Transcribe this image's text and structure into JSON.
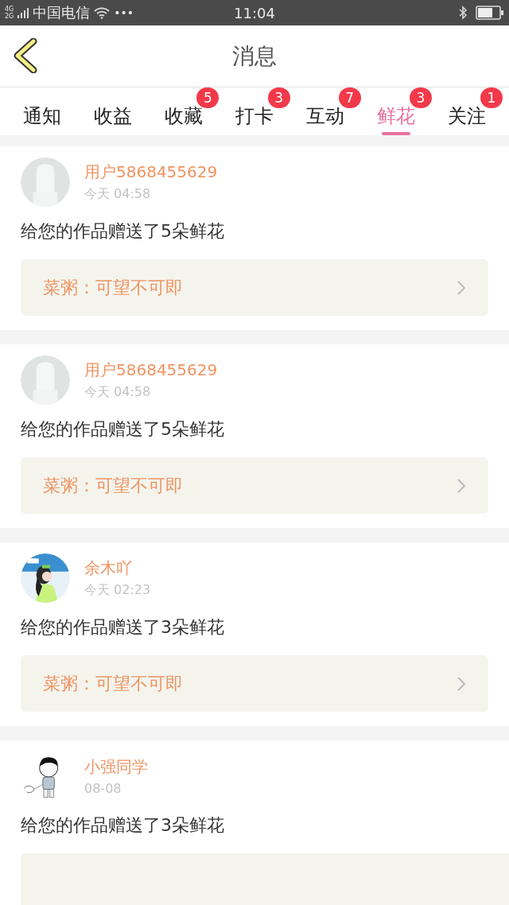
{
  "status_bar": {
    "network_top": "4G",
    "network_bottom": "2G",
    "carrier": "中国电信",
    "more": "•••",
    "time": "11:04"
  },
  "header": {
    "title": "消息"
  },
  "tabs": [
    {
      "label": "通知",
      "selected": false
    },
    {
      "label": "收益",
      "selected": false
    },
    {
      "label": "收藏",
      "selected": false,
      "badge": "5"
    },
    {
      "label": "打卡",
      "selected": false,
      "badge": "3"
    },
    {
      "label": "互动",
      "selected": false,
      "badge": "7"
    },
    {
      "label": "鲜花",
      "selected": true,
      "badge": "3"
    },
    {
      "label": "关注",
      "selected": false,
      "badge": "1"
    }
  ],
  "messages": [
    {
      "kind": "default",
      "user": "用户5868455629",
      "time": "今天 04:58",
      "text": "给您的作品赠送了5朵鲜花",
      "work": "菜粥：可望不可即"
    },
    {
      "kind": "default",
      "user": "用户5868455629",
      "time": "今天 04:58",
      "text": "给您的作品赠送了5朵鲜花",
      "work": "菜粥：可望不可即"
    },
    {
      "user": "余木吖",
      "time": "今天 02:23",
      "text": "给您的作品赠送了3朵鲜花",
      "work": "菜粥：可望不可即"
    },
    {
      "kind": "cartoon",
      "user": "小强同学",
      "time": "08-08",
      "text": "给您的作品赠送了3朵鲜花"
    }
  ]
}
